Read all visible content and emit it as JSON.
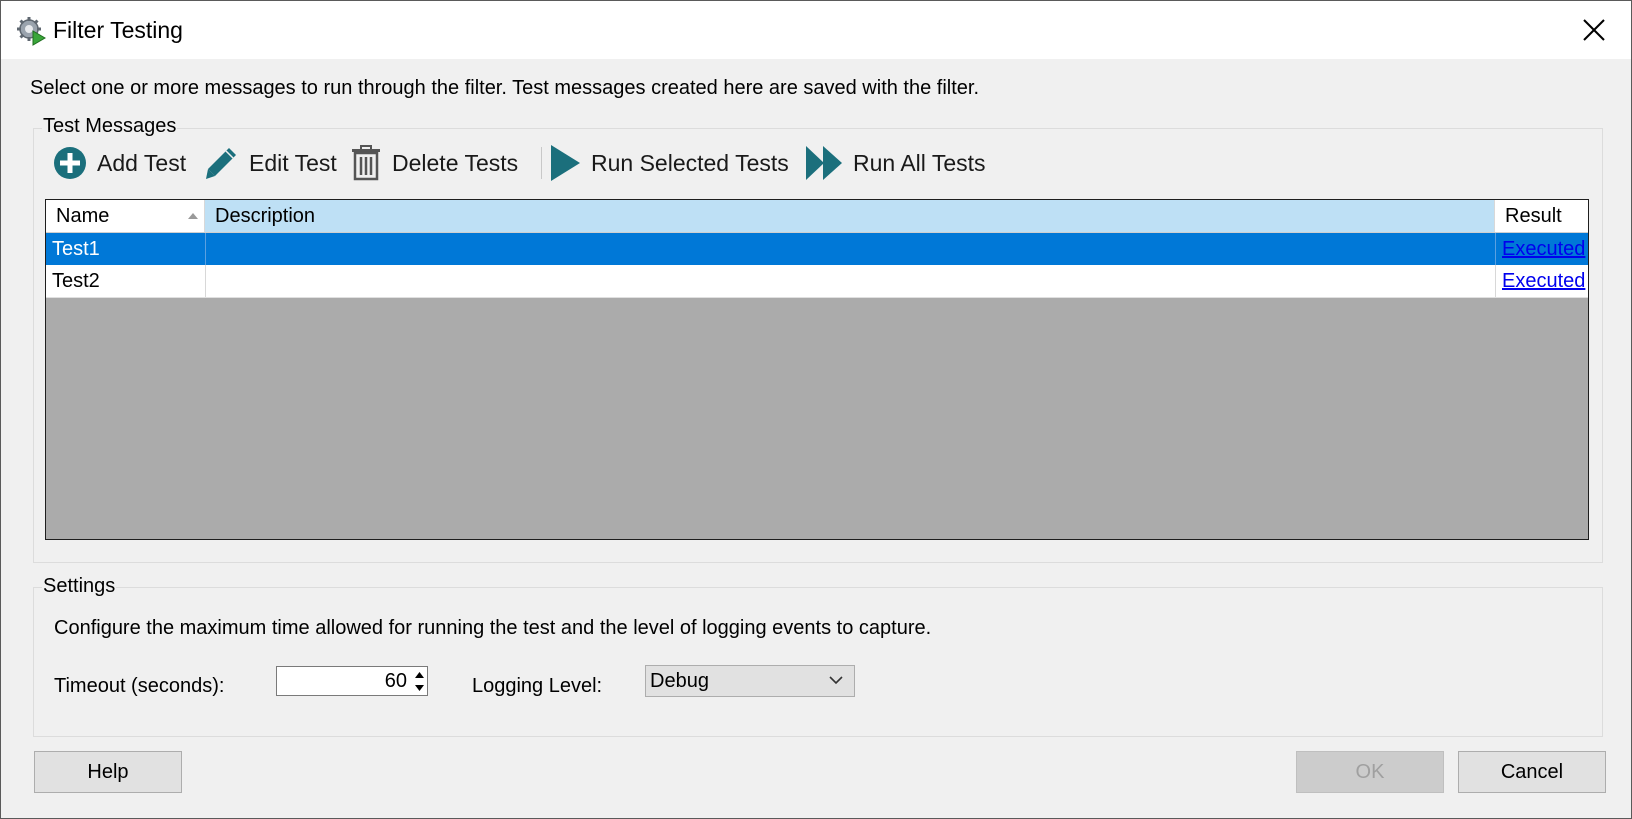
{
  "window": {
    "title": "Filter Testing",
    "icon": "gear-play-icon",
    "close_icon": "close-icon"
  },
  "intro_text": "Select one or more messages to run through the filter. Test messages created here are saved with the filter.",
  "test_messages": {
    "group_label": "Test Messages",
    "toolbar": {
      "add": "Add Test",
      "edit": "Edit Test",
      "delete": "Delete Tests",
      "run_selected": "Run Selected Tests",
      "run_all": "Run All Tests"
    },
    "columns": {
      "name": "Name",
      "description": "Description",
      "result": "Result"
    },
    "rows": [
      {
        "name": "Test1",
        "description": "",
        "result": "Executed",
        "selected": true
      },
      {
        "name": "Test2",
        "description": "",
        "result": "Executed",
        "selected": false
      }
    ]
  },
  "settings": {
    "group_label": "Settings",
    "description": "Configure the maximum time allowed for running the test and the level of logging events to capture.",
    "timeout_label": "Timeout (seconds):",
    "timeout_value": "60",
    "logging_label": "Logging Level:",
    "logging_value": "Debug"
  },
  "buttons": {
    "help": "Help",
    "ok": "OK",
    "cancel": "Cancel"
  },
  "colors": {
    "accent": "#1b6f7c",
    "selection": "#0078d7",
    "grid_empty": "#ababab",
    "header_highlight": "#bee0f5"
  }
}
